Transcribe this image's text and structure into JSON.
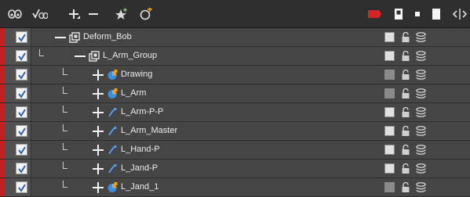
{
  "toolbar": {
    "buttons": [
      {
        "icon": "show-all-icon"
      },
      {
        "icon": "enable-all-icon"
      },
      {
        "icon": "add-layer-icon"
      },
      {
        "icon": "remove-layer-icon"
      },
      {
        "icon": "add-peg-icon"
      },
      {
        "icon": "add-drawing-icon"
      },
      {
        "icon": "color-swatch-icon"
      },
      {
        "icon": "thick-outline-icon"
      },
      {
        "icon": "small-square-icon"
      },
      {
        "icon": "large-square-icon"
      },
      {
        "icon": "expand-width-icon"
      }
    ],
    "swatch_color": "#d42626"
  },
  "layers": [
    {
      "name": "Deform_Bob",
      "type": "group",
      "depth": 0,
      "state": "collapse",
      "dark_square": false
    },
    {
      "name": "L_Arm_Group",
      "type": "group",
      "depth": 1,
      "state": "collapse",
      "dark_square": false
    },
    {
      "name": "Drawing",
      "type": "drawing",
      "depth": 2,
      "state": "expand",
      "dark_square": true
    },
    {
      "name": "L_Arm",
      "type": "drawing",
      "depth": 2,
      "state": "expand",
      "dark_square": true
    },
    {
      "name": "L_Arm-P-P",
      "type": "deformer",
      "depth": 2,
      "state": "expand",
      "dark_square": false
    },
    {
      "name": "L_Arm_Master",
      "type": "deformer",
      "depth": 2,
      "state": "expand",
      "dark_square": false
    },
    {
      "name": "L_Hand-P",
      "type": "deformer",
      "depth": 2,
      "state": "expand",
      "dark_square": false
    },
    {
      "name": "L_Jand-P",
      "type": "deformer",
      "depth": 2,
      "state": "expand",
      "dark_square": false
    },
    {
      "name": "L_Jand_1",
      "type": "drawing",
      "depth": 2,
      "state": "expand",
      "dark_square": true
    }
  ],
  "colors": {
    "layer_tag": "#c41f1f",
    "drawing_icon_blue": "#3b8fe0",
    "drawing_icon_orange": "#f0a020",
    "deformer_icon": "#4da3ff"
  }
}
